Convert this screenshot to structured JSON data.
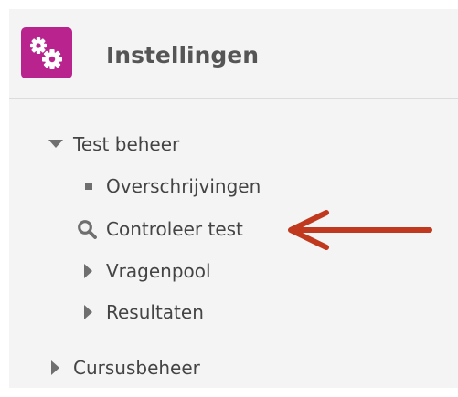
{
  "colors": {
    "accent": "#b8238d",
    "arrow": "#c0391e",
    "text": "#444444",
    "title": "#555555",
    "icon": "#6f6f6f",
    "panel": "#f4f4f4"
  },
  "header": {
    "icon": "gears-icon",
    "title": "Instellingen"
  },
  "tree": [
    {
      "label": "Test beheer",
      "icon": "caret-down-icon",
      "expanded": true
    },
    {
      "label": "Overschrijvingen",
      "icon": "square-bullet-icon"
    },
    {
      "label": "Controleer test",
      "icon": "magnifier-icon",
      "highlighted": true
    },
    {
      "label": "Vragenpool",
      "icon": "caret-right-icon",
      "expanded": false
    },
    {
      "label": "Resultaten",
      "icon": "caret-right-icon",
      "expanded": false
    },
    {
      "label": "Cursusbeheer",
      "icon": "caret-right-icon",
      "expanded": false
    }
  ],
  "annotation": {
    "icon": "red-arrow-left-icon"
  }
}
